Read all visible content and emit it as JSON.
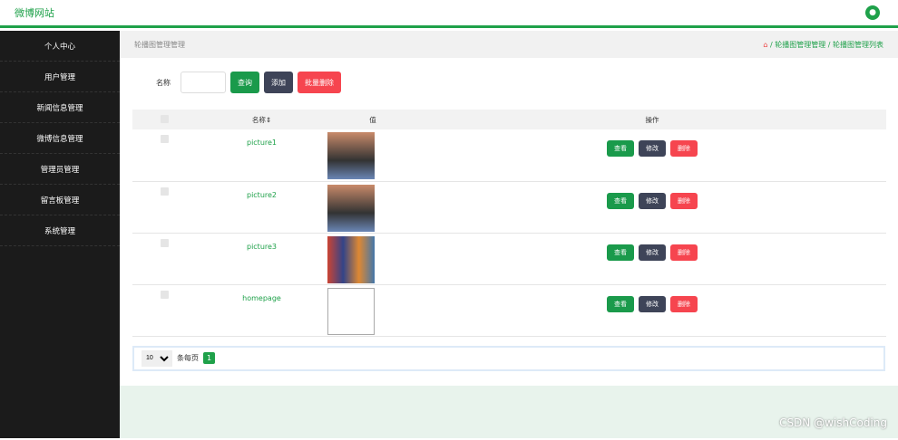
{
  "header": {
    "brand": "微博网站",
    "user_icon": "user-icon"
  },
  "sidebar": {
    "items": [
      "个人中心",
      "用户管理",
      "新闻信息管理",
      "微博信息管理",
      "管理员管理",
      "留言板管理",
      "系统管理"
    ]
  },
  "page": {
    "title": "轮播图管理管理",
    "breadcrumb": [
      "轮播图管理管理",
      "轮播图管理列表"
    ]
  },
  "search": {
    "label": "名称",
    "value": "",
    "query": "查询",
    "add": "添加",
    "batch_delete": "批量删除"
  },
  "table": {
    "headers": [
      "名称",
      "值",
      "操作"
    ],
    "rows": [
      {
        "name": "picture1"
      },
      {
        "name": "picture2"
      },
      {
        "name": "picture3"
      },
      {
        "name": "homepage"
      }
    ],
    "actions": {
      "view": "查看",
      "edit": "修改",
      "delete": "删除"
    }
  },
  "pager": {
    "page_size": "10",
    "per_page_label": "条每页",
    "current": "1"
  },
  "watermark": "CSDN @wishCoding"
}
